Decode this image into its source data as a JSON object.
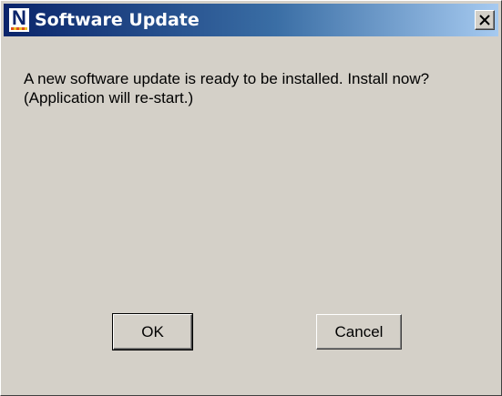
{
  "window": {
    "title": "Software Update",
    "app_icon_letter": "N",
    "close_glyph": "close-icon"
  },
  "dialog": {
    "message": "A new software update is ready to be installed. Install now? (Application will re-start.)",
    "ok_label": "OK",
    "cancel_label": "Cancel"
  },
  "colors": {
    "titlebar_start": "#0a246a",
    "titlebar_end": "#a6caf0",
    "dialog_background": "#d4d0c8"
  }
}
